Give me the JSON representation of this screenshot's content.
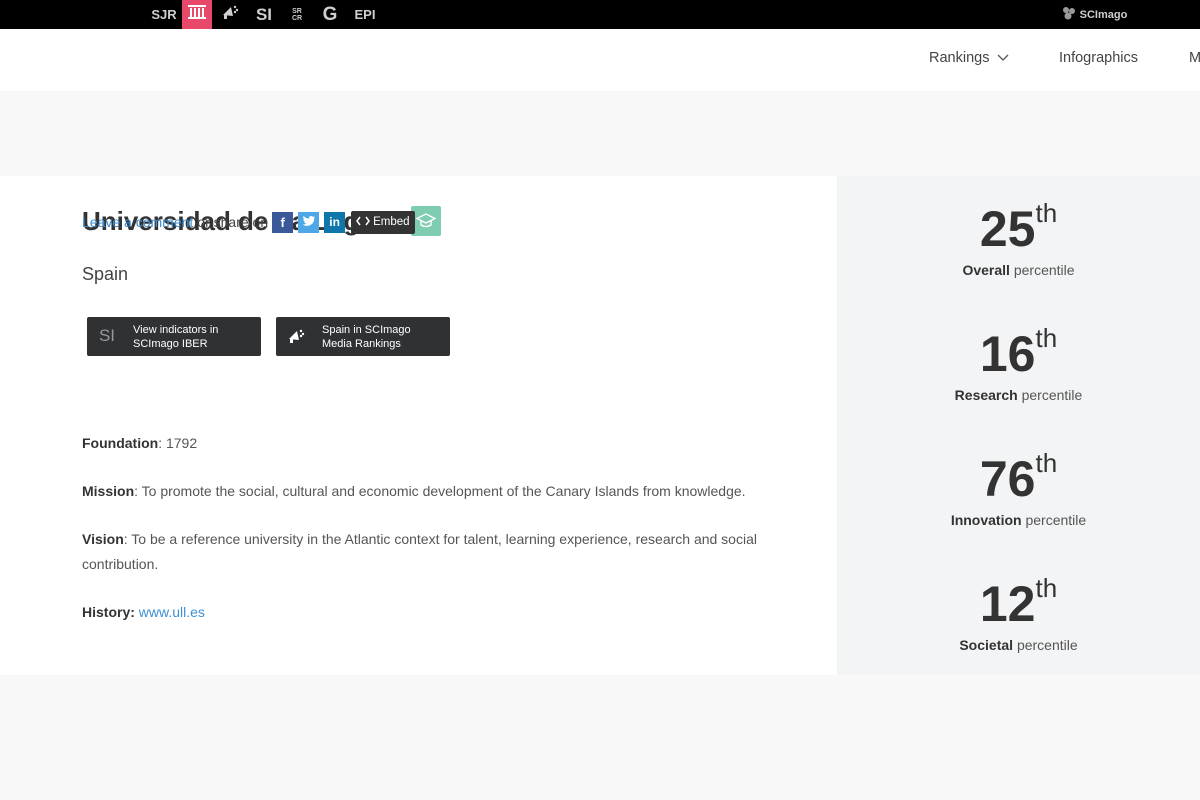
{
  "topbar": {
    "sjr": "SJR",
    "si": "SI",
    "sr_top": "SR",
    "sr_bottom": "CR",
    "g": "G",
    "epi": "EPI",
    "brand": "SCImago",
    "active_color": "#e8486a"
  },
  "nav": {
    "rankings": "Rankings",
    "infographics": "Infographics",
    "more": "M"
  },
  "institution": {
    "name": "Universidad de La Laguna",
    "badge_icon": "graduation-cap-icon",
    "country": "Spain"
  },
  "buttons": {
    "iber_icon_text": "SI",
    "iber_label": "View indicators in SCImago IBER",
    "media_label": "Spain in SCImago Media Rankings"
  },
  "share": {
    "comment": "Leave a comment",
    "or_share": "or share on",
    "facebook": "f",
    "linkedin": "in",
    "embed": "Embed"
  },
  "info": {
    "foundation_label": "Foundation",
    "foundation_value": ": 1792",
    "mission_label": "Mission",
    "mission_value": ": To promote the social, cultural and economic development of the Canary Islands from knowledge.",
    "vision_label": "Vision",
    "vision_value": ": To be a reference university in the Atlantic context for talent, learning experience, research and social contribution.",
    "history_label": "History:",
    "history_link": "www.ull.es"
  },
  "percentiles": [
    {
      "value": "25",
      "suffix": "th",
      "label": "Overall",
      "word": "percentile"
    },
    {
      "value": "16",
      "suffix": "th",
      "label": "Research",
      "word": "percentile"
    },
    {
      "value": "76",
      "suffix": "th",
      "label": "Innovation",
      "word": "percentile"
    },
    {
      "value": "12",
      "suffix": "th",
      "label": "Societal",
      "word": "percentile"
    }
  ]
}
